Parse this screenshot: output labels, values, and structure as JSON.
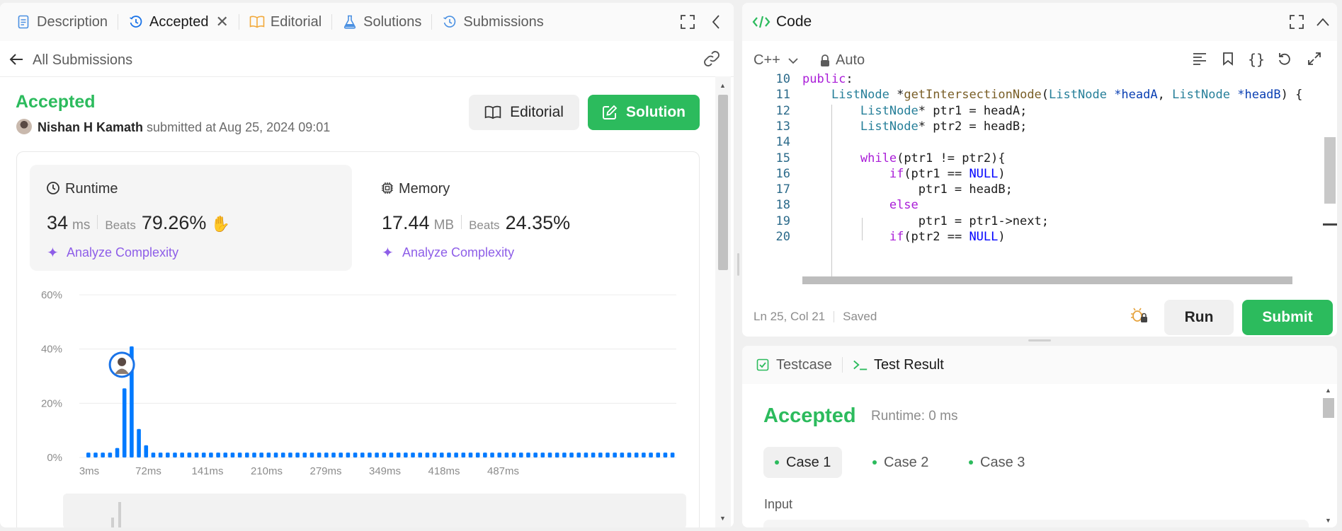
{
  "left_tabs": {
    "description": "Description",
    "accepted": "Accepted",
    "editorial": "Editorial",
    "solutions": "Solutions",
    "submissions": "Submissions"
  },
  "back_label": "All Submissions",
  "submission": {
    "status": "Accepted",
    "user": "Nishan H Kamath",
    "submitted_text": "submitted at Aug 25, 2024 09:01",
    "editorial_btn": "Editorial",
    "solution_btn": "Solution"
  },
  "runtime": {
    "label": "Runtime",
    "value": "34",
    "unit": "ms",
    "beats_label": "Beats",
    "beats": "79.26%",
    "analyze": "Analyze Complexity"
  },
  "memory": {
    "label": "Memory",
    "value": "17.44",
    "unit": "MB",
    "beats_label": "Beats",
    "beats": "24.35%",
    "analyze": "Analyze Complexity"
  },
  "chart_data": {
    "type": "bar",
    "ylim": [
      0,
      60
    ],
    "yticks": [
      "60%",
      "40%",
      "20%",
      "0%"
    ],
    "xticks": [
      "3ms",
      "72ms",
      "141ms",
      "210ms",
      "279ms",
      "349ms",
      "418ms",
      "487ms"
    ],
    "values": [
      1.8,
      1.8,
      1.8,
      1.8,
      3.5,
      25.5,
      41,
      10.5,
      4.5,
      1.8,
      1.8,
      1.8,
      1.8,
      1.8,
      1.8,
      1.8,
      1.8,
      1.8,
      1.8,
      1.8,
      1.8,
      1.8,
      1.8,
      1.8,
      1.8,
      1.8,
      1.8,
      1.8,
      1.8,
      1.8,
      1.8,
      1.8,
      1.8,
      1.8,
      1.8,
      1.8,
      1.8,
      1.8,
      1.8,
      1.8,
      1.8,
      1.8,
      1.8,
      1.8,
      1.8,
      1.8,
      1.8,
      1.8,
      1.8,
      1.8,
      1.8,
      1.8,
      1.8,
      1.8,
      1.8,
      1.8,
      1.8,
      1.8,
      1.8,
      1.8,
      1.8,
      1.8,
      1.8,
      1.8,
      1.8,
      1.8,
      1.8,
      1.8,
      1.8,
      1.8,
      1.8,
      1.8,
      1.8,
      1.8,
      1.8,
      1.8,
      1.8,
      1.8,
      1.8,
      1.8,
      1.8,
      1.8
    ],
    "highlight_index": 6,
    "bar_color": "#007aff"
  },
  "code_panel": {
    "title": "Code",
    "language": "C++",
    "mode": "Auto",
    "status_pos": "Ln 25, Col 21",
    "status_saved": "Saved",
    "run": "Run",
    "submit": "Submit"
  },
  "code_lines": [
    {
      "n": "10",
      "t": "public:"
    },
    {
      "n": "11",
      "t": "    ListNode *getIntersectionNode(ListNode *headA, ListNode *headB) {"
    },
    {
      "n": "12",
      "t": "        ListNode* ptr1 = headA;"
    },
    {
      "n": "13",
      "t": "        ListNode* ptr2 = headB;"
    },
    {
      "n": "14",
      "t": ""
    },
    {
      "n": "15",
      "t": "        while(ptr1 != ptr2){"
    },
    {
      "n": "16",
      "t": "            if(ptr1 == NULL)"
    },
    {
      "n": "17",
      "t": "                ptr1 = headB;"
    },
    {
      "n": "18",
      "t": "            else"
    },
    {
      "n": "19",
      "t": "                ptr1 = ptr1->next;"
    },
    {
      "n": "20",
      "t": "            if(ptr2 == NULL)"
    }
  ],
  "result_tabs": {
    "testcase": "Testcase",
    "test_result": "Test Result"
  },
  "result": {
    "status": "Accepted",
    "runtime": "Runtime: 0 ms",
    "cases": [
      "Case 1",
      "Case 2",
      "Case 3"
    ],
    "input_label": "Input"
  },
  "colors": {
    "accent_green": "#2cbb5d",
    "link_purple": "#8e5ee8",
    "chart_blue": "#007aff"
  }
}
